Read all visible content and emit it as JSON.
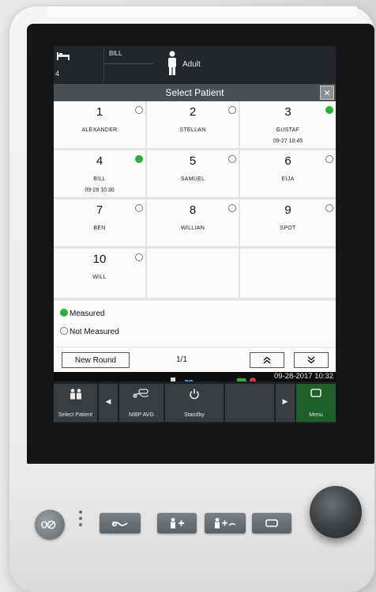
{
  "header": {
    "bed_number": "4",
    "patient_name": "BILL",
    "patient_type": "Adult"
  },
  "dialog": {
    "title": "Select Patient",
    "close_label": "×"
  },
  "patients": [
    {
      "number": "1",
      "name": "ALEXANDER",
      "time": "",
      "measured": false
    },
    {
      "number": "2",
      "name": "STELLAN",
      "time": "",
      "measured": false
    },
    {
      "number": "3",
      "name": "GUSTAF",
      "time": "09-27 10:45",
      "measured": true
    },
    {
      "number": "4",
      "name": "BILL",
      "time": "09-28 10:30",
      "measured": true
    },
    {
      "number": "5",
      "name": "SAMUEL",
      "time": "",
      "measured": false
    },
    {
      "number": "6",
      "name": "EIJA",
      "time": "",
      "measured": false
    },
    {
      "number": "7",
      "name": "BEN",
      "time": "",
      "measured": false
    },
    {
      "number": "8",
      "name": "WILLIAN",
      "time": "",
      "measured": false
    },
    {
      "number": "9",
      "name": "SPOT",
      "time": "",
      "measured": false
    },
    {
      "number": "10",
      "name": "WILL",
      "time": "",
      "measured": false
    }
  ],
  "legend": {
    "measured": "Measured",
    "not_measured": "Not Measured"
  },
  "footer": {
    "new_round": "New Round",
    "page": "1/1",
    "up_label": "«",
    "down_label": "»"
  },
  "status": {
    "datetime": "09-28-2017 10:32"
  },
  "menu": {
    "select_patient": "Select Patient",
    "nibp_avg": "NIBP AVG",
    "standby": "Standby",
    "menu": "Menu",
    "prev": "◀",
    "next": "▶"
  },
  "colors": {
    "measured_green": "#2fae3a",
    "menu_active": "#1e5e29",
    "screen_bg": "#262a2d"
  }
}
